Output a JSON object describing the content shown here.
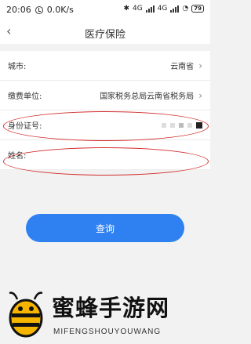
{
  "status_bar": {
    "time": "20:06",
    "network_speed": "0.0K/s",
    "signal_1": "4G",
    "signal_2": "4G",
    "battery": "79"
  },
  "nav": {
    "back_icon": "chevron-left-icon",
    "title": "医疗保险"
  },
  "form": {
    "city_label": "城市:",
    "city_value": "云南省",
    "unit_label": "缴费单位:",
    "unit_value": "国家税务总局云南省税务局",
    "id_label": "身份证号:",
    "name_label": "姓名:"
  },
  "button": {
    "query_label": "查询"
  },
  "watermark": {
    "title": "蜜蜂手游网",
    "subtitle": "MIFENGSHOUYOUWANG"
  },
  "colors": {
    "accent": "#2f80f0",
    "highlight": "#d22b2b"
  }
}
